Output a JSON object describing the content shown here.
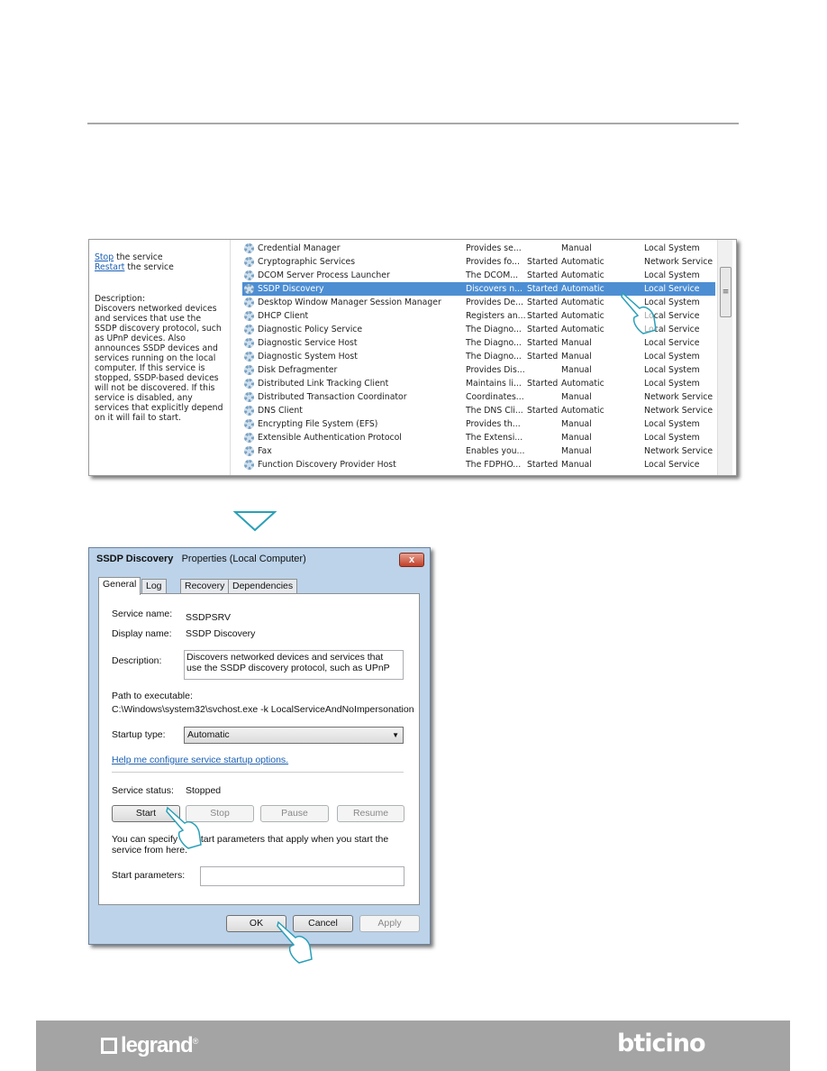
{
  "services_panel": {
    "stop_link": "Stop",
    "stop_suffix": " the service",
    "restart_link": "Restart",
    "restart_suffix": " the service",
    "description_label": "Description:",
    "description_text": "Discovers networked devices and services that use the SSDP discovery protocol, such as UPnP devices. Also announces SSDP devices and services running on the local computer. If this service is stopped, SSDP-based devices will not be discovered. If this service is disabled, any services that explicitly depend on it will fail to start.",
    "selected_row": 3,
    "rows": [
      {
        "name": "Credential Manager",
        "description": "Provides se...",
        "status": "",
        "startup": "Manual",
        "logon": "Local System"
      },
      {
        "name": "Cryptographic Services",
        "description": "Provides fo...",
        "status": "Started",
        "startup": "Automatic",
        "logon": "Network Service"
      },
      {
        "name": "DCOM Server Process Launcher",
        "description": "The DCOM...",
        "status": "Started",
        "startup": "Automatic",
        "logon": "Local System"
      },
      {
        "name": "SSDP Discovery",
        "description": "Discovers n...",
        "status": "Started",
        "startup": "Automatic",
        "logon": "Local Service"
      },
      {
        "name": "Desktop Window Manager Session Manager",
        "description": "Provides De...",
        "status": "Started",
        "startup": "Automatic",
        "logon": "Local System"
      },
      {
        "name": "DHCP Client",
        "description": "Registers an...",
        "status": "Started",
        "startup": "Automatic",
        "logon": "Local Service"
      },
      {
        "name": "Diagnostic Policy Service",
        "description": "The Diagno...",
        "status": "Started",
        "startup": "Automatic",
        "logon": "Local Service"
      },
      {
        "name": "Diagnostic Service Host",
        "description": "The Diagno...",
        "status": "Started",
        "startup": "Manual",
        "logon": "Local Service"
      },
      {
        "name": "Diagnostic System Host",
        "description": "The Diagno...",
        "status": "Started",
        "startup": "Manual",
        "logon": "Local System"
      },
      {
        "name": "Disk Defragmenter",
        "description": "Provides Dis...",
        "status": "",
        "startup": "Manual",
        "logon": "Local System"
      },
      {
        "name": "Distributed Link Tracking Client",
        "description": "Maintains li...",
        "status": "Started",
        "startup": "Automatic",
        "logon": "Local System"
      },
      {
        "name": "Distributed Transaction Coordinator",
        "description": "Coordinates...",
        "status": "",
        "startup": "Manual",
        "logon": "Network Service"
      },
      {
        "name": "DNS Client",
        "description": "The DNS Cli...",
        "status": "Started",
        "startup": "Automatic",
        "logon": "Network Service"
      },
      {
        "name": "Encrypting File System (EFS)",
        "description": "Provides th...",
        "status": "",
        "startup": "Manual",
        "logon": "Local System"
      },
      {
        "name": "Extensible Authentication Protocol",
        "description": "The Extensi...",
        "status": "",
        "startup": "Manual",
        "logon": "Local System"
      },
      {
        "name": "Fax",
        "description": "Enables you...",
        "status": "",
        "startup": "Manual",
        "logon": "Network Service"
      },
      {
        "name": "Function Discovery Provider Host",
        "description": "The FDPHO...",
        "status": "Started",
        "startup": "Manual",
        "logon": "Local Service"
      }
    ],
    "scroll_grip": "≡"
  },
  "dialog": {
    "title_bold": "SSDP Discovery",
    "title_rest": "Properties (Local Computer)",
    "close_glyph": "x",
    "tabs": [
      "General",
      "Log On",
      "Recovery",
      "Dependencies"
    ],
    "active_tab": "General",
    "service_name_label": "Service name:",
    "service_name": "SSDPSRV",
    "display_name_label": "Display name:",
    "display_name": "SSDP Discovery",
    "description_label": "Description:",
    "description": "Discovers networked devices and services that use the SSDP discovery protocol, such as UPnP",
    "path_label": "Path to executable:",
    "path": "C:\\Windows\\system32\\svchost.exe -k LocalServiceAndNoImpersonation",
    "startup_label": "Startup type:",
    "startup_value": "Automatic",
    "help_link": "Help me configure service startup options.",
    "status_label": "Service status:",
    "status_value": "Stopped",
    "start": "Start",
    "stop": "Stop",
    "pause": "Pause",
    "resume": "Resume",
    "hint": "You can specify the start parameters that apply when you start the service from here.",
    "params_label": "Start parameters:",
    "params_value": "",
    "ok": "OK",
    "cancel": "Cancel",
    "apply": "Apply"
  },
  "footer": {
    "logo_left": "legrand",
    "logo_right": "bticino"
  },
  "colors": {
    "selection": "#4d8ed3",
    "accent": "#2aa0b8",
    "footer": "#a4a4a4",
    "link": "#1a5fb4"
  }
}
